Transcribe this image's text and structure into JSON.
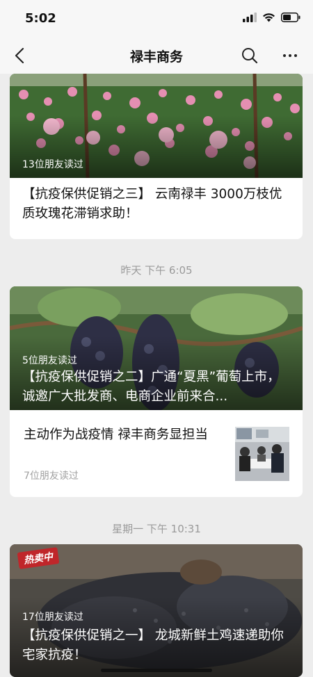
{
  "status": {
    "time": "5:02"
  },
  "nav": {
    "title": "禄丰商务"
  },
  "articles": [
    {
      "reads": "13位朋友读过",
      "title": "【抗疫保供促销之三】 云南禄丰 3000万枝优质玫瑰花滞销求助！"
    },
    {
      "timestamp": "昨天 下午 6:05",
      "reads": "5位朋友读过",
      "title": "【抗疫保供促销之二】广通“夏黑”葡萄上市，诚邀广大批发商、电商企业前来合...",
      "sub": {
        "title": "主动作为战疫情  禄丰商务显担当",
        "reads": "7位朋友读过"
      }
    },
    {
      "timestamp": "星期一 下午 10:31",
      "badge": "热卖中",
      "reads": "17位朋友读过",
      "title": "【抗疫保供促销之一】 龙城新鲜土鸡速递助你宅家抗疫！"
    }
  ]
}
